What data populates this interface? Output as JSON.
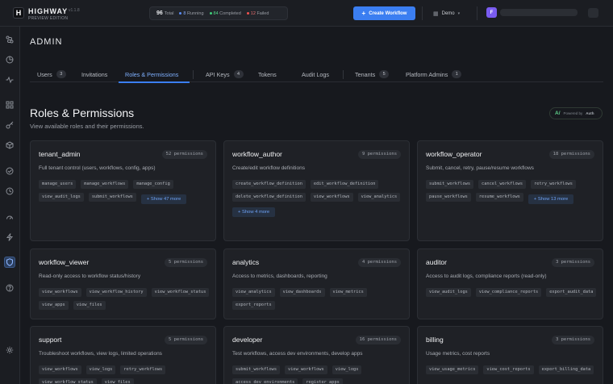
{
  "app": {
    "logo_letter": "H",
    "brand": "HIGHWAY",
    "version": "v1.1.8",
    "edition": "PREVIEW EDITION"
  },
  "stats": {
    "total_value": "96",
    "total_label": "Total",
    "running_value": "8",
    "running_label": "Running",
    "completed_value": "84",
    "completed_label": "Completed",
    "failed_value": "12",
    "failed_label": "Failed"
  },
  "colors": {
    "accent": "#3b7ef1",
    "running": "#5b8cf5",
    "completed": "#3fcf79",
    "failed": "#ef5350",
    "avatar": "#7a5cf0"
  },
  "topbar": {
    "create_label": "Create Workflow",
    "tenant_label": "Demo",
    "avatar_letter": "F"
  },
  "sidebar": {
    "items": [
      "workflows-icon",
      "history-icon",
      "activity-icon",
      "apps-icon",
      "keys-icon",
      "packages-icon",
      "approvals-icon",
      "schedules-icon",
      "dashboard-icon",
      "triggers-icon",
      "admin-shield-icon",
      "help-icon",
      "settings-icon"
    ]
  },
  "page": {
    "title": "ADMIN"
  },
  "tabs": [
    {
      "label": "Users",
      "count": "3"
    },
    {
      "label": "Invitations"
    },
    {
      "label": "Roles & Permissions",
      "active": true
    },
    {
      "label": "API Keys",
      "count": "4"
    },
    {
      "label": "Tokens"
    },
    {
      "label": "Audit Logs"
    },
    {
      "label": "Tenants",
      "count": "5"
    },
    {
      "label": "Platform Admins",
      "count": "1"
    }
  ],
  "section": {
    "title": "Roles & Permissions",
    "subtitle": "View available roles and their permissions.",
    "powered_by": "Powered by",
    "powered_brand": "Auth",
    "powered_icon": "A/"
  },
  "roles": [
    {
      "name": "tenant_admin",
      "count": "52 permissions",
      "desc": "Full tenant control (users, workflows, config, apps)",
      "perms": [
        "manage_users",
        "manage_workflows",
        "manage_config",
        "view_audit_logs",
        "submit_workflows"
      ],
      "more": "Show 47 more"
    },
    {
      "name": "workflow_author",
      "count": "9 permissions",
      "desc": "Create/edit workflow definitions",
      "perms": [
        "create_workflow_definition",
        "edit_workflow_definition",
        "delete_workflow_definition",
        "view_workflows",
        "view_analytics"
      ],
      "more": "Show 4 more"
    },
    {
      "name": "workflow_operator",
      "count": "18 permissions",
      "desc": "Submit, cancel, retry, pause/resume workflows",
      "perms": [
        "submit_workflows",
        "cancel_workflows",
        "retry_workflows",
        "pause_workflows",
        "resume_workflows"
      ],
      "more": "Show 13 more"
    },
    {
      "name": "workflow_viewer",
      "count": "5 permissions",
      "desc": "Read-only access to workflow status/history",
      "perms": [
        "view_workflows",
        "view_workflow_history",
        "view_workflow_status",
        "view_apps",
        "view_files"
      ]
    },
    {
      "name": "analytics",
      "count": "4 permissions",
      "desc": "Access to metrics, dashboards, reporting",
      "perms": [
        "view_analytics",
        "view_dashboards",
        "view_metrics",
        "export_reports"
      ]
    },
    {
      "name": "auditor",
      "count": "3 permissions",
      "desc": "Access to audit logs, compliance reports (read-only)",
      "perms": [
        "view_audit_logs",
        "view_compliance_reports",
        "export_audit_data"
      ]
    },
    {
      "name": "support",
      "count": "5 permissions",
      "desc": "Troubleshoot workflows, view logs, limited operations",
      "perms": [
        "view_workflows",
        "view_logs",
        "retry_workflows",
        "view_workflow_status",
        "view_files"
      ]
    },
    {
      "name": "developer",
      "count": "16 permissions",
      "desc": "Test workflows, access dev environments, develop apps",
      "perms": [
        "submit_workflows",
        "view_workflows",
        "view_logs",
        "access_dev_environments",
        "register_apps"
      ]
    },
    {
      "name": "billing",
      "count": "3 permissions",
      "desc": "Usage metrics, cost reports",
      "perms": [
        "view_usage_metrics",
        "view_cost_reports",
        "export_billing_data"
      ]
    }
  ]
}
